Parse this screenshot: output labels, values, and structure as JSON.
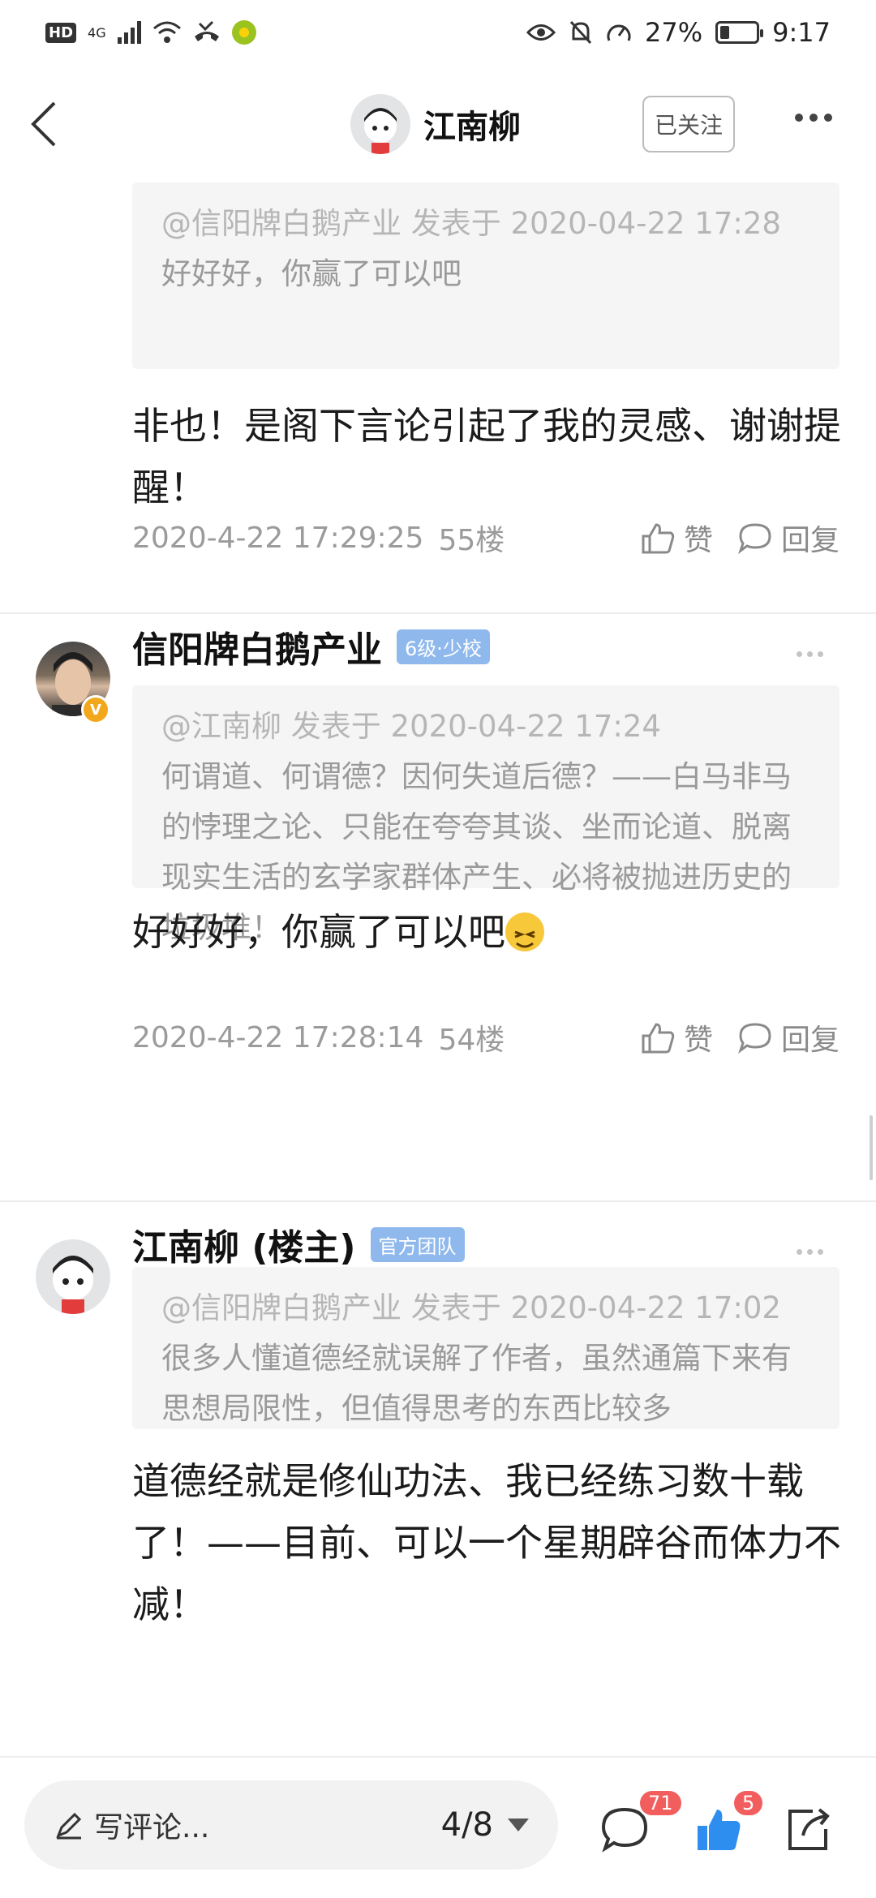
{
  "status_bar": {
    "hd": "HD",
    "network": "4G",
    "battery": "27%",
    "battery_level": 0.27,
    "time": "9:17"
  },
  "header": {
    "title": "江南柳",
    "follow_label": "已关注"
  },
  "posts": [
    {
      "quote_head": "@信阳牌白鹅产业 发表于 2020-04-22 17:28",
      "quote_body": "好好好，你赢了可以吧",
      "text": "非也！是阁下言论引起了我的灵感、谢谢提醒！",
      "time": "2020-4-22 17:29:25",
      "floor": "55楼",
      "like_label": "赞",
      "reply_label": "回复"
    },
    {
      "username": "信阳牌白鹅产业",
      "badge": "6级·少校",
      "verified": "V",
      "quote_head": "@江南柳 发表于 2020-04-22 17:24",
      "quote_body": "何谓道、何谓德？因何失道后德？——白马非马的悖理之论、只能在夸夸其谈、坐而论道、脱离现实生活的玄学家群体产生、必将被抛进历史的垃圾堆！",
      "text": "好好好，你赢了可以吧",
      "time": "2020-4-22 17:28:14",
      "floor": "54楼",
      "like_label": "赞",
      "reply_label": "回复"
    },
    {
      "username": "江南柳 (楼主)",
      "badge": "官方团队",
      "quote_head": "@信阳牌白鹅产业 发表于 2020-04-22 17:02",
      "quote_body": "很多人懂道德经就误解了作者，虽然通篇下来有思想局限性，但值得思考的东西比较多",
      "text": "道德经就是修仙功法、我已经练习数十载了！——目前、可以一个星期辟谷而体力不减！"
    }
  ],
  "bottom_bar": {
    "placeholder": "写评论...",
    "page_indicator": "4/8",
    "comment_count": "71",
    "like_count": "5"
  },
  "colors": {
    "accent_blue": "#2e8ef0",
    "badge_blue": "#8fb8ec",
    "count_red": "#f25e5e",
    "verified_orange": "#f2a81d"
  },
  "icons": [
    "back-arrow-icon",
    "more-icon",
    "like-icon",
    "reply-icon",
    "pen-icon",
    "comment-icon",
    "thumb-up-icon",
    "share-icon"
  ]
}
